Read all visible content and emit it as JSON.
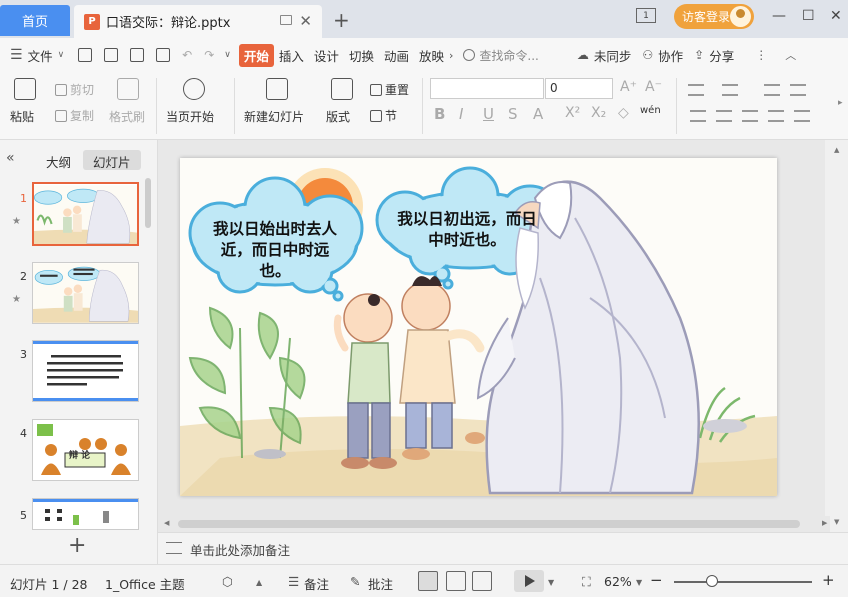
{
  "titlebar": {
    "home_tab": "首页",
    "doc_icon": "P",
    "doc_title": "口语交际：辩论.pptx",
    "new_tab_icon": "+",
    "login_label": "访客登录",
    "win_badge": "1",
    "minimize": "—",
    "maximize": "☐",
    "close": "✕",
    "tab_close": "✕"
  },
  "menubar": {
    "file": "文件",
    "tabs": [
      "开始",
      "插入",
      "设计",
      "切换",
      "动画",
      "放映"
    ],
    "search_placeholder": "查找命令...",
    "sync": "未同步",
    "collab": "协作",
    "share": "分享"
  },
  "ribbon": {
    "paste": "粘贴",
    "cut": "剪切",
    "copy": "复制",
    "format_painter": "格式刷",
    "from_current": "当页开始",
    "new_slide": "新建幻灯片",
    "layout": "版式",
    "reset": "重置",
    "section": "节",
    "font_size": "0",
    "wen": "wén"
  },
  "leftpane": {
    "tab_outline": "大纲",
    "tab_slides": "幻灯片",
    "thumb_numbers": [
      "1",
      "2",
      "3",
      "4",
      "5"
    ],
    "debate_label": "辩  论"
  },
  "slide": {
    "bubble_left": "我以日始出时去人近，而日中时远也。",
    "bubble_right": "我以日初出远，而日中时近也。"
  },
  "notes": {
    "placeholder": "单击此处添加备注"
  },
  "statusbar": {
    "slide_counter": "幻灯片 1 / 28",
    "theme": "1_Office 主题",
    "notes": "备注",
    "comments": "批注",
    "zoom": "62%"
  },
  "colors": {
    "accent": "#e8643c",
    "home_tab": "#4a8ff0",
    "login": "#f0a23c"
  }
}
